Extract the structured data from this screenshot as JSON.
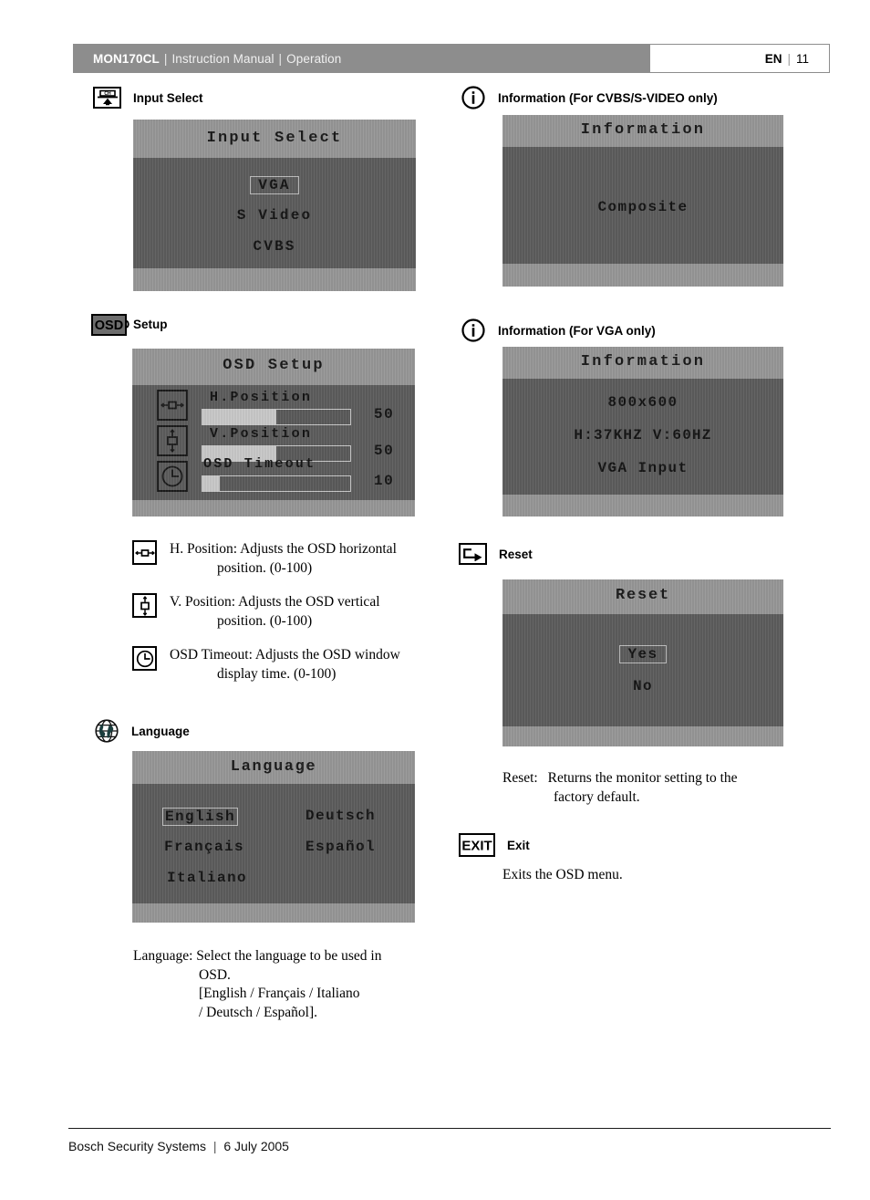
{
  "header": {
    "product": "MON170CL",
    "sep1": "|",
    "doc": "Instruction Manual",
    "sep2": "|",
    "section": "Operation",
    "lang_code": "EN",
    "page_sep": "|",
    "page_number": "11",
    "bg_color": "#8d8d8d"
  },
  "sections": {
    "input_select": {
      "icon": "channel-input-icon",
      "heading": "Input Select",
      "osd": {
        "title": "Input Select",
        "options": [
          "VGA",
          "S Video",
          "CVBS"
        ],
        "selected": "VGA"
      }
    },
    "information_cvbs": {
      "icon": "info-circle-icon",
      "heading": "Information (For CVBS/S-VIDEO only)",
      "osd": {
        "title": "Information",
        "lines": [
          "Composite"
        ]
      }
    },
    "osd_setup": {
      "icon": "osd-icon",
      "heading": "OSD Setup",
      "osd": {
        "title": "OSD Setup",
        "items": [
          {
            "icon": "h-position-icon",
            "label": "H.Position",
            "value": "50",
            "percent": 50
          },
          {
            "icon": "v-position-icon",
            "label": "V.Position",
            "value": "50",
            "percent": 50
          },
          {
            "icon": "clock-icon",
            "label": "OSD Timeout",
            "value": "10",
            "percent": 10
          }
        ]
      },
      "descriptions": [
        {
          "icon": "h-position-icon",
          "line1": "H. Position: Adjusts the OSD horizontal",
          "line2": "position. (0-100)"
        },
        {
          "icon": "v-position-icon",
          "line1": "V. Position: Adjusts the OSD vertical",
          "line2": "position. (0-100)"
        },
        {
          "icon": "clock-icon",
          "line1": "OSD Timeout: Adjusts the OSD window",
          "line2": "display time. (0-100)"
        }
      ]
    },
    "information_vga": {
      "icon": "info-circle-icon",
      "heading": "Information (For VGA only)",
      "osd": {
        "title": "Information",
        "lines": [
          "800x600",
          "H:37KHZ V:60HZ",
          "VGA Input"
        ]
      }
    },
    "language": {
      "icon": "globe-icon",
      "heading": "Language",
      "osd": {
        "title": "Language",
        "options_left": [
          "English",
          "Français",
          "Italiano"
        ],
        "options_right": [
          "Deutsch",
          "Español"
        ],
        "selected": "English"
      },
      "description": {
        "line1": "Language: Select the language to be used in",
        "line2": "OSD.",
        "line3": "[English / Français / Italiano",
        "line4": "/ Deutsch / Español]."
      }
    },
    "reset": {
      "icon": "reset-arrow-icon",
      "heading": "Reset",
      "osd": {
        "title": "Reset",
        "options": [
          "Yes",
          "No"
        ],
        "selected": "Yes"
      },
      "description": {
        "term": "Reset:",
        "line1": "Returns the monitor setting to the",
        "line2": "factory default."
      }
    },
    "exit": {
      "icon": "exit-icon",
      "icon_text": "EXIT",
      "heading": "Exit",
      "description": "Exits the OSD menu."
    }
  },
  "footer": {
    "company": "Bosch Security Systems",
    "sep": "|",
    "date": "6 July 2005"
  }
}
